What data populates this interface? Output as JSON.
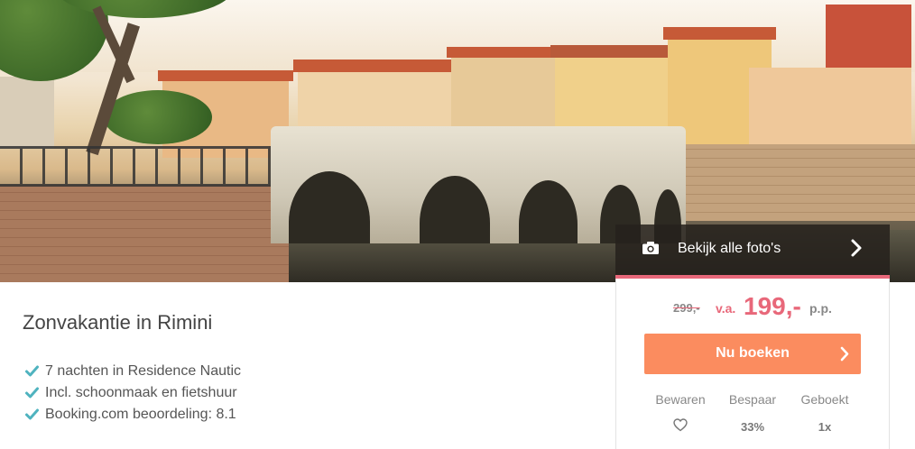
{
  "photos_button": {
    "label": "Bekijk alle foto's",
    "icon": "camera-icon"
  },
  "offer": {
    "title": "Zonvakantie in Rimini",
    "features": [
      "7 nachten in Residence Nautic",
      "Incl. schoonmaak en fietshuur",
      "Booking.com beoordeling: 8.1"
    ]
  },
  "pricing": {
    "old_price": "299,-",
    "prefix": "v.a.",
    "price": "199,-",
    "suffix": "p.p."
  },
  "book_button": {
    "label": "Nu boeken"
  },
  "stats": {
    "save_label": "Bewaren",
    "discount_label": "Bespaar",
    "discount_value": "33%",
    "booked_label": "Geboekt",
    "booked_value": "1x"
  },
  "colors": {
    "accent_pink": "#e8687a",
    "button_orange": "#fb8c5f",
    "check_teal": "#4fb3bf"
  }
}
